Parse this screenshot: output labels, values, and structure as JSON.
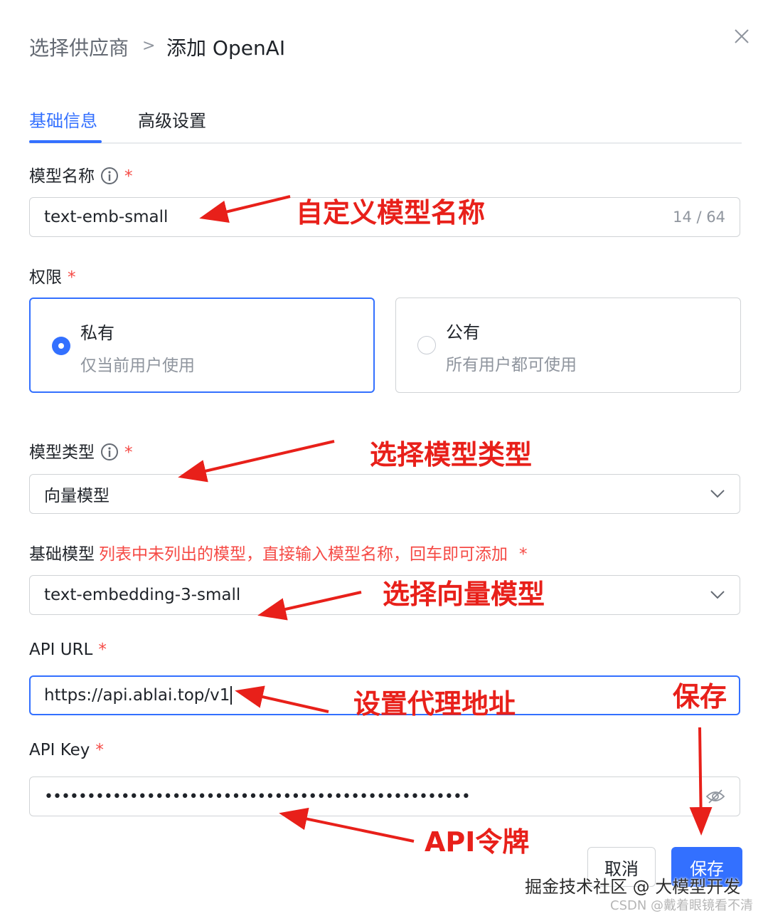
{
  "header": {
    "breadcrumb_prev": "选择供应商",
    "breadcrumb_sep": ">",
    "breadcrumb_current": "添加 OpenAI"
  },
  "tabs": [
    {
      "label": "基础信息",
      "active": true
    },
    {
      "label": "高级设置",
      "active": false
    }
  ],
  "form": {
    "model_name": {
      "label": "模型名称",
      "required_mark": "*",
      "value": "text-emb-small",
      "counter": "14 / 64"
    },
    "permission": {
      "label": "权限",
      "required_mark": "*",
      "options": [
        {
          "title": "私有",
          "desc": "仅当前用户使用",
          "selected": true
        },
        {
          "title": "公有",
          "desc": "所有用户都可使用",
          "selected": false
        }
      ]
    },
    "model_type": {
      "label": "模型类型",
      "required_mark": "*",
      "value": "向量模型"
    },
    "base_model": {
      "label": "基础模型",
      "hint": "列表中未列出的模型，直接输入模型名称，回车即可添加",
      "required_mark": "*",
      "value": "text-embedding-3-small"
    },
    "api_url": {
      "label": "API URL",
      "required_mark": "*",
      "value": "https://api.ablai.top/v1"
    },
    "api_key": {
      "label": "API Key",
      "required_mark": "*",
      "value": "••••••••••••••••••••••••••••••••••••••••••••••••••"
    }
  },
  "buttons": {
    "cancel": "取消",
    "save": "保存"
  },
  "annotations": {
    "model_name": "自定义模型名称",
    "model_type": "选择模型类型",
    "base_model": "选择向量模型",
    "api_url": "设置代理地址",
    "save": "保存",
    "api_key": "API令牌"
  },
  "watermarks": {
    "line1": "掘金技术社区 @ 大模型开发",
    "line2": "CSDN @戴着眼镜看不清"
  },
  "colors": {
    "primary": "#3370ff",
    "required": "#f54a45",
    "annotation": "#e8201a"
  }
}
